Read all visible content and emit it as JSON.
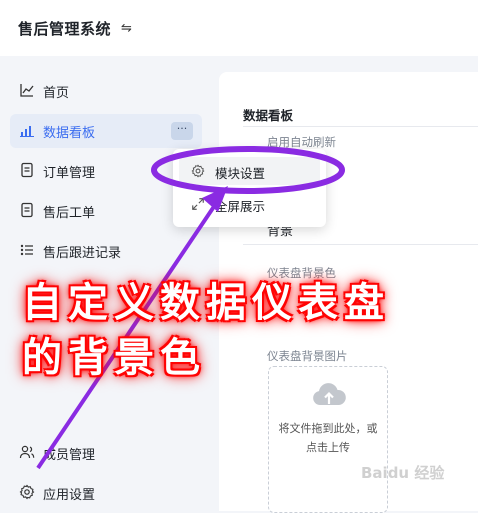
{
  "header": {
    "app_title": "售后管理系统",
    "toggle_icon": "⇋"
  },
  "sidebar": {
    "items": [
      {
        "label": "首页",
        "icon": "chart-line-icon"
      },
      {
        "label": "数据看板",
        "icon": "bar-chart-icon",
        "active": true,
        "more": "···"
      },
      {
        "label": "订单管理",
        "icon": "document-icon"
      },
      {
        "label": "售后工单",
        "icon": "document-icon"
      },
      {
        "label": "售后跟进记录",
        "icon": "list-icon"
      },
      {
        "label": "成员管理",
        "icon": "users-icon"
      },
      {
        "label": "应用设置",
        "icon": "gear-icon"
      }
    ]
  },
  "context_menu": {
    "items": [
      {
        "label": "模块设置",
        "icon": "gear-icon"
      },
      {
        "label": "全屏展示",
        "icon": "expand-icon"
      }
    ]
  },
  "panel": {
    "title": "数据看板",
    "auto_refresh_label": "启用自动刷新",
    "background_text": "背景",
    "bg_color_label": "仪表盘背景色",
    "bg_image_label": "仪表盘背景图片",
    "upload_line1": "将文件拖到此处，或",
    "upload_line2": "点击上传"
  },
  "annotation": {
    "line1": "自定义数据仪表盘",
    "line2": "的背景色",
    "accent_color": "#8a2be2",
    "text_glow_color": "#ff0000"
  },
  "watermark": "Baidu 经验",
  "colors": {
    "active_nav": "#e6ecf7",
    "accent_blue": "#3b6df0"
  }
}
